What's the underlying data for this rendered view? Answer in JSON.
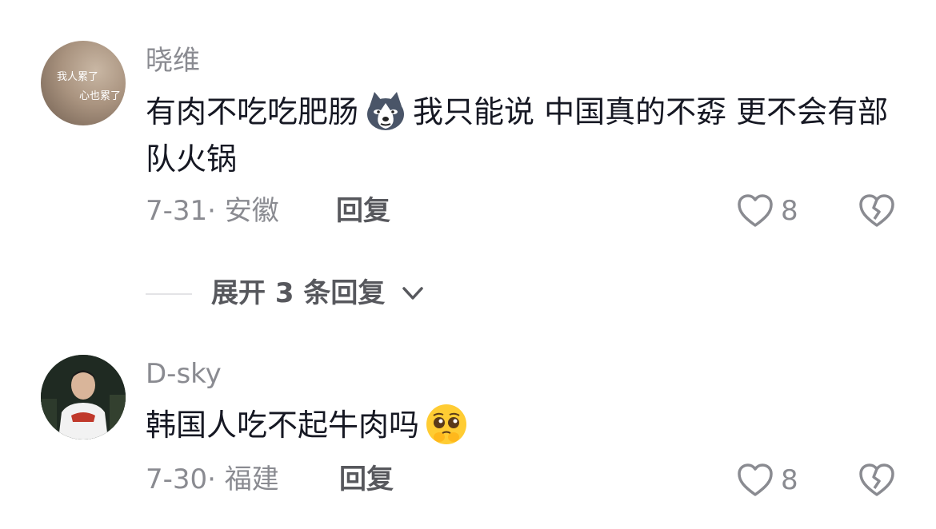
{
  "comments": [
    {
      "username": "晓维",
      "avatar_text_1": "我人累了",
      "avatar_text_2": "心也累了",
      "content_part1": "有肉不吃吃肥肠",
      "emoji": "husky-face-emoji",
      "content_part2": "我只能说 中国真的不孬 更不会有部队火锅",
      "date_location": "7-31· 安徽",
      "reply_label": "回复",
      "likes": "8"
    },
    {
      "username": "D-sky",
      "content_part1": "韩国人吃不起牛肉吗",
      "emoji": "pleading-face-emoji",
      "date_location": "7-30· 福建",
      "reply_label": "回复",
      "likes": "8"
    }
  ],
  "expand_replies": {
    "label": "展开 3 条回复"
  },
  "icons": {
    "like": "heart-outline-icon",
    "dislike": "broken-heart-icon",
    "expand": "chevron-down-icon"
  },
  "colors": {
    "username": "#8a8b91",
    "text": "#161823",
    "reply": "#57585d"
  }
}
